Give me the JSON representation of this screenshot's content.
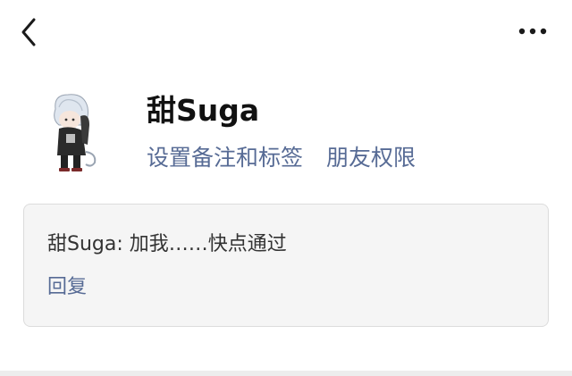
{
  "header": {
    "back_icon": "chevron-left-icon",
    "more_icon": "more-dots-icon"
  },
  "profile": {
    "nickname": "甜Suga",
    "avatar": "anime-character-avatar",
    "actions": {
      "set_remark_label": "设置备注和标签",
      "permissions_label": "朋友权限"
    }
  },
  "request": {
    "sender": "甜Suga:",
    "message": "加我……快点通过",
    "reply_label": "回复"
  },
  "colors": {
    "link": "#576b95",
    "card_bg": "#f5f5f5",
    "text": "#111111"
  }
}
